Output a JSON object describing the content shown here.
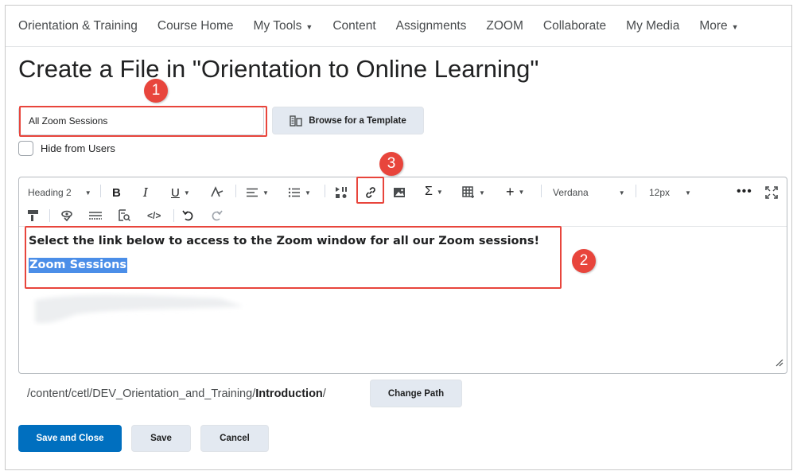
{
  "nav": {
    "items": [
      {
        "label": "Orientation & Training",
        "dropdown": false
      },
      {
        "label": "Course Home",
        "dropdown": false
      },
      {
        "label": "My Tools",
        "dropdown": true
      },
      {
        "label": "Content",
        "dropdown": false
      },
      {
        "label": "Assignments",
        "dropdown": false
      },
      {
        "label": "ZOOM",
        "dropdown": false
      },
      {
        "label": "Collaborate",
        "dropdown": false
      },
      {
        "label": "My Media",
        "dropdown": false
      },
      {
        "label": "More",
        "dropdown": true
      }
    ]
  },
  "page": {
    "title": "Create a File in \"Orientation to Online Learning\""
  },
  "form": {
    "title_value": "All Zoom Sessions",
    "browse_label": "Browse for a Template",
    "hide_label": "Hide from Users",
    "hide_checked": false
  },
  "toolbar": {
    "format": "Heading 2",
    "font": "Verdana",
    "size": "12px"
  },
  "editor": {
    "line1": "Select the link below to access to the Zoom window for all our Zoom sessions!",
    "link_text": "Zoom Sessions"
  },
  "path": {
    "prefix": "/content/cetl/DEV_Orientation_and_Training/",
    "folder": "Introduction",
    "suffix": "/",
    "change_label": "Change Path"
  },
  "buttons": {
    "save_close": "Save and Close",
    "save": "Save",
    "cancel": "Cancel"
  },
  "callouts": {
    "one": "1",
    "two": "2",
    "three": "3"
  },
  "colors": {
    "primary": "#006fbf",
    "callout": "#e8453c",
    "link_highlight": "#4b8ee8"
  }
}
